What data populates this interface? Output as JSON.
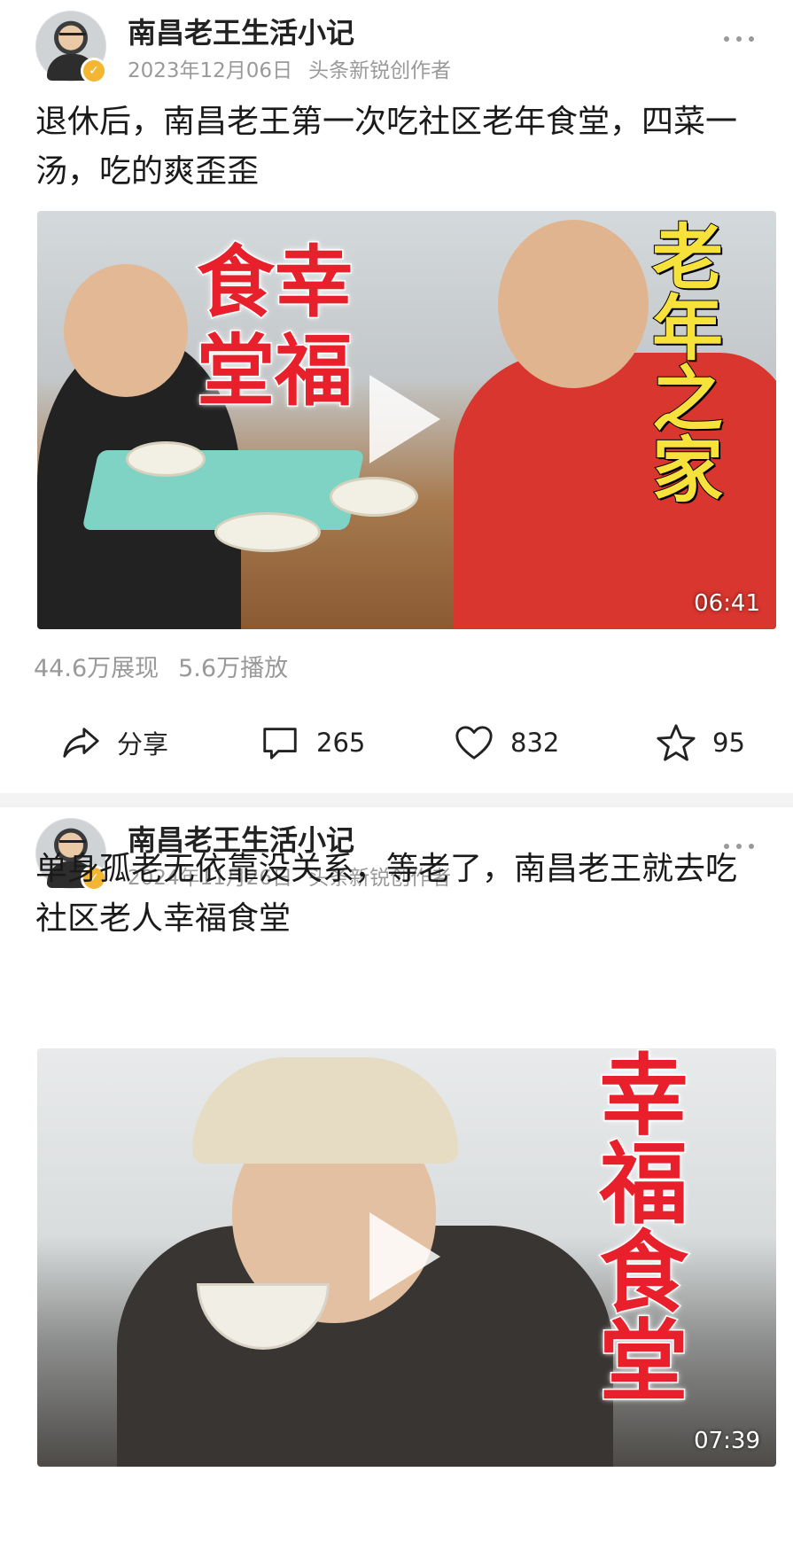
{
  "posts": [
    {
      "author": "南昌老王生活小记",
      "date": "2023年12月06日",
      "badge_text": "头条新锐创作者",
      "title": "退休后，南昌老王第一次吃社区老年食堂，四菜一汤，吃的爽歪歪",
      "video": {
        "overlay_texts": [
          "食幸",
          "堂福",
          "老年之家"
        ],
        "duration": "06:41"
      },
      "stats": {
        "impressions": "44.6万展现",
        "plays": "5.6万播放"
      },
      "actions": {
        "share_label": "分享",
        "comments": "265",
        "likes": "832",
        "favorites": "95"
      }
    },
    {
      "author": "南昌老王生活小记",
      "date": "2024年11月26日",
      "badge_text": "头条新锐创作者",
      "title": "单身孤老无依靠没关系，等老了，南昌老王就去吃社区老人幸福食堂",
      "video": {
        "overlay_texts": [
          "幸福食堂"
        ],
        "duration": "07:39"
      }
    }
  ],
  "colors": {
    "overlay_red": "#e8202c",
    "overlay_yellow": "#f6e23b",
    "verified_badge": "#f2b632",
    "meta_gray": "#9a9a9a"
  },
  "icons": [
    "verified-badge-icon",
    "more-dots-icon",
    "play-icon",
    "share-icon",
    "comment-icon",
    "like-heart-icon",
    "favorite-star-icon"
  ]
}
